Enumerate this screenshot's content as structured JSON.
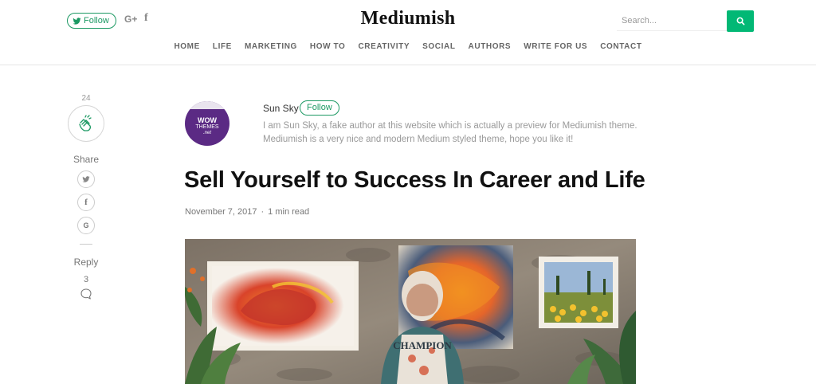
{
  "header": {
    "follow_label": "Follow",
    "gplus_label": "G+",
    "facebook_label": "f",
    "site_title": "Mediumish",
    "search_placeholder": "Search...",
    "accent_color": "#02b875"
  },
  "nav": {
    "items": [
      "HOME",
      "LIFE",
      "MARKETING",
      "HOW TO",
      "CREATIVITY",
      "SOCIAL",
      "AUTHORS",
      "WRITE FOR US",
      "CONTACT"
    ]
  },
  "sidebar": {
    "clap_count": "24",
    "share_label": "Share",
    "share_icons": [
      "twitter-icon",
      "facebook-icon",
      "google-icon"
    ],
    "twitter_glyph": "",
    "facebook_glyph": "f",
    "google_glyph": "G",
    "reply_label": "Reply",
    "reply_count": "3"
  },
  "author": {
    "name": "Sun Sky",
    "follow_label": "Follow",
    "bio": "I am Sun Sky, a fake author at this website which is actually a preview for Mediumish theme. Mediumish is a very nice and modern Medium styled theme, hope you like it!",
    "avatar_wow": "WOW",
    "avatar_themes": "THEMES",
    "avatar_net": ".net"
  },
  "post": {
    "title": "Sell Yourself to Success In Career and Life",
    "date": "November 7, 2017",
    "separator": "·",
    "read_time": "1 min read"
  },
  "hero": {
    "shirt_text": "CHAMPION"
  }
}
